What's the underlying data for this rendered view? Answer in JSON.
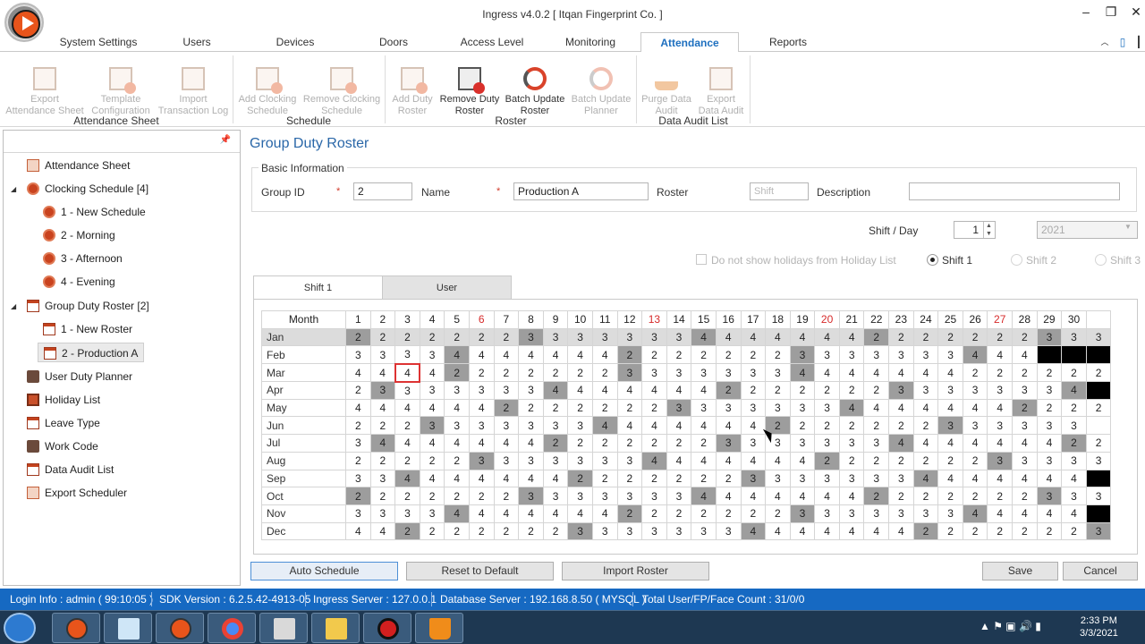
{
  "window": {
    "title": "Ingress v4.0.2 [ Itqan Fingerprint Co. ]",
    "min": "–",
    "max": "❐",
    "close": "✕"
  },
  "menu_tabs": [
    "System Settings",
    "Users",
    "Devices",
    "Doors",
    "Access Level",
    "Monitoring",
    "Attendance",
    "Reports"
  ],
  "menu_active": "Attendance",
  "ribbon": {
    "export_attendance": "Export\nAttendance Sheet",
    "template_config": "Template\nConfiguration",
    "import_log": "Import\nTransaction Log",
    "group_attendance": "Attendance Sheet",
    "add_clocking": "Add Clocking\nSchedule",
    "remove_clocking": "Remove Clocking\nSchedule",
    "group_schedule": "Schedule",
    "add_duty": "Add Duty\nRoster",
    "remove_duty": "Remove Duty\nRoster",
    "batch_update_roster": "Batch Update\nRoster",
    "batch_update_planner": "Batch Update\nPlanner",
    "group_roster": "Roster",
    "purge_audit": "Purge Data\nAudit",
    "export_audit": "Export\nData Audit",
    "group_audit": "Data Audit List"
  },
  "tree": {
    "attendance_sheet": "Attendance Sheet",
    "clocking_schedule": "Clocking Schedule [4]",
    "cs_1": "1 - New Schedule",
    "cs_2": "2 - Morning",
    "cs_3": "3 - Afternoon",
    "cs_4": "4 - Evening",
    "group_duty": "Group Duty Roster [2]",
    "gd_1": "1 - New Roster",
    "gd_2": "2 - Production A",
    "user_duty": "User Duty Planner",
    "holiday": "Holiday List",
    "leave": "Leave Type",
    "work_code": "Work Code",
    "data_audit": "Data Audit List",
    "export_sched": "Export Scheduler"
  },
  "form": {
    "title": "Group Duty Roster",
    "basic_info": "Basic Information",
    "group_id_label": "Group ID",
    "group_id": "2",
    "name_label": "Name",
    "name": "Production A",
    "roster_label": "Roster",
    "shift_placeholder": "Shift",
    "description_label": "Description",
    "description": "",
    "required_mark": "*",
    "shift_day_label": "Shift / Day",
    "shift_day": "1",
    "year": "2021",
    "holiday_checkbox": "Do not show holidays from Holiday List",
    "shift1": "Shift 1",
    "shift2": "Shift 2",
    "shift3": "Shift 3"
  },
  "tabs": [
    "Shift 1",
    "User"
  ],
  "roster": {
    "month_header": "Month",
    "days": [
      "1",
      "2",
      "3",
      "4",
      "5",
      "6",
      "7",
      "8",
      "9",
      "10",
      "11",
      "12",
      "13",
      "14",
      "15",
      "16",
      "17",
      "18",
      "19",
      "20",
      "21",
      "22",
      "23",
      "24",
      "25",
      "26",
      "27",
      "28",
      "29",
      "30",
      ""
    ],
    "red_days": [
      6,
      13,
      20,
      27
    ],
    "months": [
      "Jan",
      "Feb",
      "Mar",
      "Apr",
      "May",
      "Jun",
      "Jul",
      "Aug",
      "Sep",
      "Oct",
      "Nov",
      "Dec"
    ],
    "values": [
      [
        2,
        2,
        2,
        2,
        2,
        2,
        2,
        3,
        3,
        3,
        3,
        3,
        3,
        3,
        4,
        4,
        4,
        4,
        4,
        4,
        4,
        2,
        2,
        2,
        2,
        2,
        2,
        2,
        3,
        3,
        3
      ],
      [
        3,
        3,
        3,
        3,
        4,
        4,
        4,
        4,
        4,
        4,
        4,
        2,
        2,
        2,
        2,
        2,
        2,
        2,
        3,
        3,
        3,
        3,
        3,
        3,
        3,
        4,
        4,
        4,
        "",
        "",
        ""
      ],
      [
        4,
        4,
        4,
        4,
        2,
        2,
        2,
        2,
        2,
        2,
        2,
        3,
        3,
        3,
        3,
        3,
        3,
        3,
        4,
        4,
        4,
        4,
        4,
        4,
        4,
        2,
        2,
        2,
        2,
        2,
        2
      ],
      [
        2,
        3,
        3,
        3,
        3,
        3,
        3,
        3,
        4,
        4,
        4,
        4,
        4,
        4,
        4,
        2,
        2,
        2,
        2,
        2,
        2,
        2,
        3,
        3,
        3,
        3,
        3,
        3,
        3,
        4,
        ""
      ],
      [
        4,
        4,
        4,
        4,
        4,
        4,
        2,
        2,
        2,
        2,
        2,
        2,
        2,
        3,
        3,
        3,
        3,
        3,
        3,
        3,
        4,
        4,
        4,
        4,
        4,
        4,
        4,
        2,
        2,
        2,
        2
      ],
      [
        2,
        2,
        2,
        3,
        3,
        3,
        3,
        3,
        3,
        3,
        4,
        4,
        4,
        4,
        4,
        4,
        4,
        2,
        2,
        2,
        2,
        2,
        2,
        2,
        3,
        3,
        3,
        3,
        3,
        3,
        ""
      ],
      [
        3,
        4,
        4,
        4,
        4,
        4,
        4,
        4,
        2,
        2,
        2,
        2,
        2,
        2,
        2,
        3,
        3,
        3,
        3,
        3,
        3,
        3,
        4,
        4,
        4,
        4,
        4,
        4,
        4,
        2,
        2
      ],
      [
        2,
        2,
        2,
        2,
        2,
        3,
        3,
        3,
        3,
        3,
        3,
        3,
        4,
        4,
        4,
        4,
        4,
        4,
        4,
        2,
        2,
        2,
        2,
        2,
        2,
        2,
        3,
        3,
        3,
        3,
        3
      ],
      [
        3,
        3,
        4,
        4,
        4,
        4,
        4,
        4,
        4,
        2,
        2,
        2,
        2,
        2,
        2,
        2,
        3,
        3,
        3,
        3,
        3,
        3,
        3,
        4,
        4,
        4,
        4,
        4,
        4,
        4,
        ""
      ],
      [
        2,
        2,
        2,
        2,
        2,
        2,
        2,
        3,
        3,
        3,
        3,
        3,
        3,
        3,
        4,
        4,
        4,
        4,
        4,
        4,
        4,
        2,
        2,
        2,
        2,
        2,
        2,
        2,
        3,
        3,
        3
      ],
      [
        3,
        3,
        3,
        3,
        4,
        4,
        4,
        4,
        4,
        4,
        4,
        2,
        2,
        2,
        2,
        2,
        2,
        2,
        3,
        3,
        3,
        3,
        3,
        3,
        3,
        4,
        4,
        4,
        4,
        4,
        ""
      ],
      [
        4,
        4,
        2,
        2,
        2,
        2,
        2,
        2,
        2,
        3,
        3,
        3,
        3,
        3,
        3,
        3,
        4,
        4,
        4,
        4,
        4,
        4,
        4,
        2,
        2,
        2,
        2,
        2,
        2,
        2,
        3
      ]
    ],
    "gray": [
      [
        1,
        8,
        15,
        22,
        29
      ],
      [
        5,
        12,
        19,
        26
      ],
      [
        5,
        12,
        19
      ],
      [
        2,
        9,
        16,
        23,
        30
      ],
      [
        7,
        14,
        21,
        28
      ],
      [
        4,
        11,
        18,
        25
      ],
      [
        2,
        9,
        16,
        23,
        30
      ],
      [
        6,
        13,
        20,
        27
      ],
      [
        3,
        10,
        17,
        24
      ],
      [
        1,
        8,
        15,
        22,
        29
      ],
      [
        5,
        12,
        19,
        26
      ],
      [
        3,
        10,
        17,
        24,
        31
      ]
    ],
    "black": [
      [],
      [
        29,
        30,
        31
      ],
      [],
      [
        31
      ],
      [],
      [],
      [],
      [],
      [
        31
      ],
      [],
      [
        31
      ],
      []
    ],
    "selected": [
      2,
      3
    ]
  },
  "buttons": {
    "auto": "Auto Schedule",
    "reset": "Reset to Default",
    "import": "Import Roster",
    "save": "Save",
    "cancel": "Cancel"
  },
  "status": {
    "login": "Login Info : admin ( 99:10:05 )",
    "sdk": "SDK Version : 6.2.5.42-4913-05",
    "server": "Ingress Server : 127.0.0.1",
    "db": "Database Server : 192.168.8.50 ( MYSQL )",
    "count": "Total User/FP/Face Count : 31/0/0"
  },
  "clock": {
    "time": "2:33 PM",
    "date": "3/3/2021"
  },
  "colors": {
    "accent": "#1d6fbf",
    "statusbar": "#1669c2",
    "gray_cell": "#9d9d9d"
  }
}
